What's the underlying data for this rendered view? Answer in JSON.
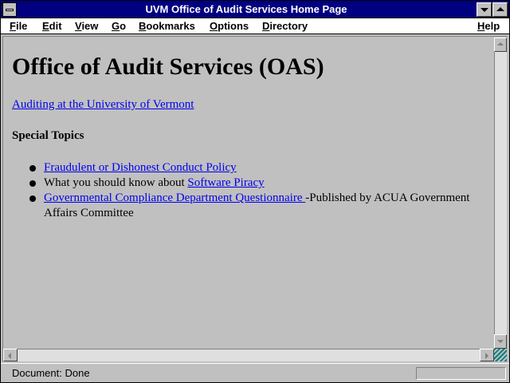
{
  "window": {
    "title": "UVM Office of Audit Services Home Page"
  },
  "menubar": {
    "items": [
      {
        "key": "F",
        "rest": "ile"
      },
      {
        "key": "E",
        "rest": "dit"
      },
      {
        "key": "V",
        "rest": "iew"
      },
      {
        "key": "G",
        "rest": "o"
      },
      {
        "key": "B",
        "rest": "ookmarks"
      },
      {
        "key": "O",
        "rest": "ptions"
      },
      {
        "key": "D",
        "rest": "irectory"
      },
      {
        "key": "H",
        "rest": "elp"
      }
    ]
  },
  "page": {
    "heading": "Office of Audit Services (OAS)",
    "intro_link": "Auditing at the University of Vermont",
    "special_topics": "Special Topics",
    "bullets": [
      {
        "link": "Fraudulent or Dishonest Conduct Policy"
      },
      {
        "prefix": "What you should know about ",
        "link": "Software Piracy"
      },
      {
        "link": "Governmental Compliance Department Questionnaire ",
        "suffix": "-Published by ACUA Government Affairs Committee"
      }
    ]
  },
  "status": {
    "text": "Document: Done"
  },
  "colors": {
    "titlebar": "#000080",
    "link": "#0000ee",
    "chrome": "#c0c0c0"
  }
}
